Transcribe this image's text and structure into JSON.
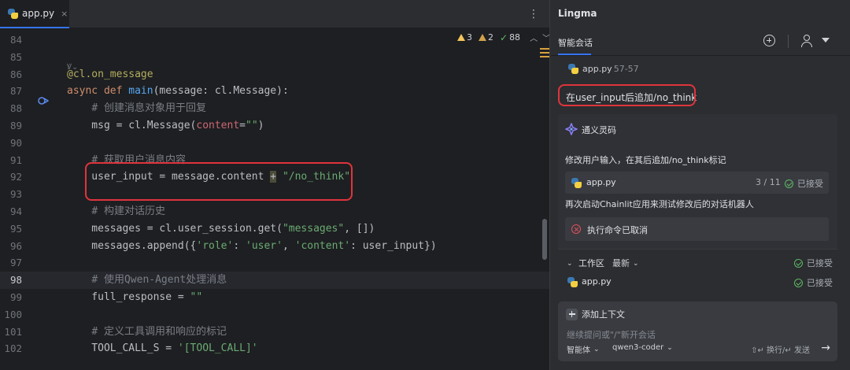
{
  "editor": {
    "tab": {
      "label": "app.py",
      "close": "×"
    },
    "inspections": {
      "warnings": "3",
      "weak_warnings": "2",
      "typos": "88"
    },
    "fold_hint": "Ꝟ⌄",
    "lines": [
      {
        "num": "84",
        "html": ""
      },
      {
        "num": "85",
        "html": ""
      },
      {
        "num": "86",
        "html": "<span class=\"dec\">@cl.on_message</span>"
      },
      {
        "num": "87",
        "html": "<span class=\"kw\">async def</span> <span class=\"fn\">main</span>(message: cl.Message):"
      },
      {
        "num": "88",
        "html": "    <span class=\"cmt\"># 创建消息对象用于回复</span>"
      },
      {
        "num": "89",
        "html": "    msg = cl.Message(<span class=\"param\">content</span>=<span class=\"str\">\"\"</span>)"
      },
      {
        "num": "90",
        "html": ""
      },
      {
        "num": "91",
        "html": "    <span class=\"cmt\"># 获取用户消息内容</span>"
      },
      {
        "num": "92",
        "html": "    user_input = message.content <span class=\"caret-box\">+</span> <span class=\"str\">\"/no_think\"</span>"
      },
      {
        "num": "93",
        "html": ""
      },
      {
        "num": "94",
        "html": "    <span class=\"cmt\"># 构建对话历史</span>"
      },
      {
        "num": "95",
        "html": "    messages = cl.user_session.get(<span class=\"str\">\"messages\"</span>, [])"
      },
      {
        "num": "96",
        "html": "    messages.append({<span class=\"str\">'role'</span>: <span class=\"str\">'user'</span>, <span class=\"str\">'content'</span>: user_input})"
      },
      {
        "num": "97",
        "html": ""
      },
      {
        "num": "98",
        "html": "    <span class=\"cmt\"># 使用Qwen-Agent处理消息</span>",
        "current": true
      },
      {
        "num": "99",
        "html": "    full_response = <span class=\"str\">\"\"</span>"
      },
      {
        "num": "100",
        "html": ""
      },
      {
        "num": "101",
        "html": "    <span class=\"cmt\"># 定义工具调用和响应的标记</span>"
      },
      {
        "num": "102",
        "html": "    TOOL_CALL_S = <span class=\"str\">'[TOOL_CALL]'</span>"
      }
    ]
  },
  "lingma": {
    "title": "Lingma",
    "tab": "智能会话",
    "user_message": {
      "file_name": "app.py",
      "file_range": "57-57",
      "text": "在user_input后追加/no_think"
    },
    "reply": {
      "bot_name": "通义灵码",
      "text1": "修改用户输入，在其后追加/no_think标记",
      "file_card": {
        "name": "app.py",
        "count": "3 / 11",
        "status": "已接受"
      },
      "text2": "再次启动Chainlit应用来测试修改后的对话机器人",
      "command": "执行命令已取消"
    },
    "workspace": {
      "caret": "⌄",
      "label": "工作区",
      "filter": "最新",
      "status": "已接受",
      "file": {
        "name": "app.py",
        "status": "已接受"
      }
    },
    "input": {
      "add_context": "添加上下文",
      "placeholder": "继续提问或\"/\"新开会话",
      "mode": "智能体",
      "model": "qwen3-coder",
      "hint": "⇧↵ 换行/↵ 发送",
      "send": "→"
    }
  },
  "colors": {
    "accent": "#3574f0",
    "highlight_box": "#e0343c",
    "accepted_green": "#5fb865",
    "cancel_red": "#e0505a"
  }
}
